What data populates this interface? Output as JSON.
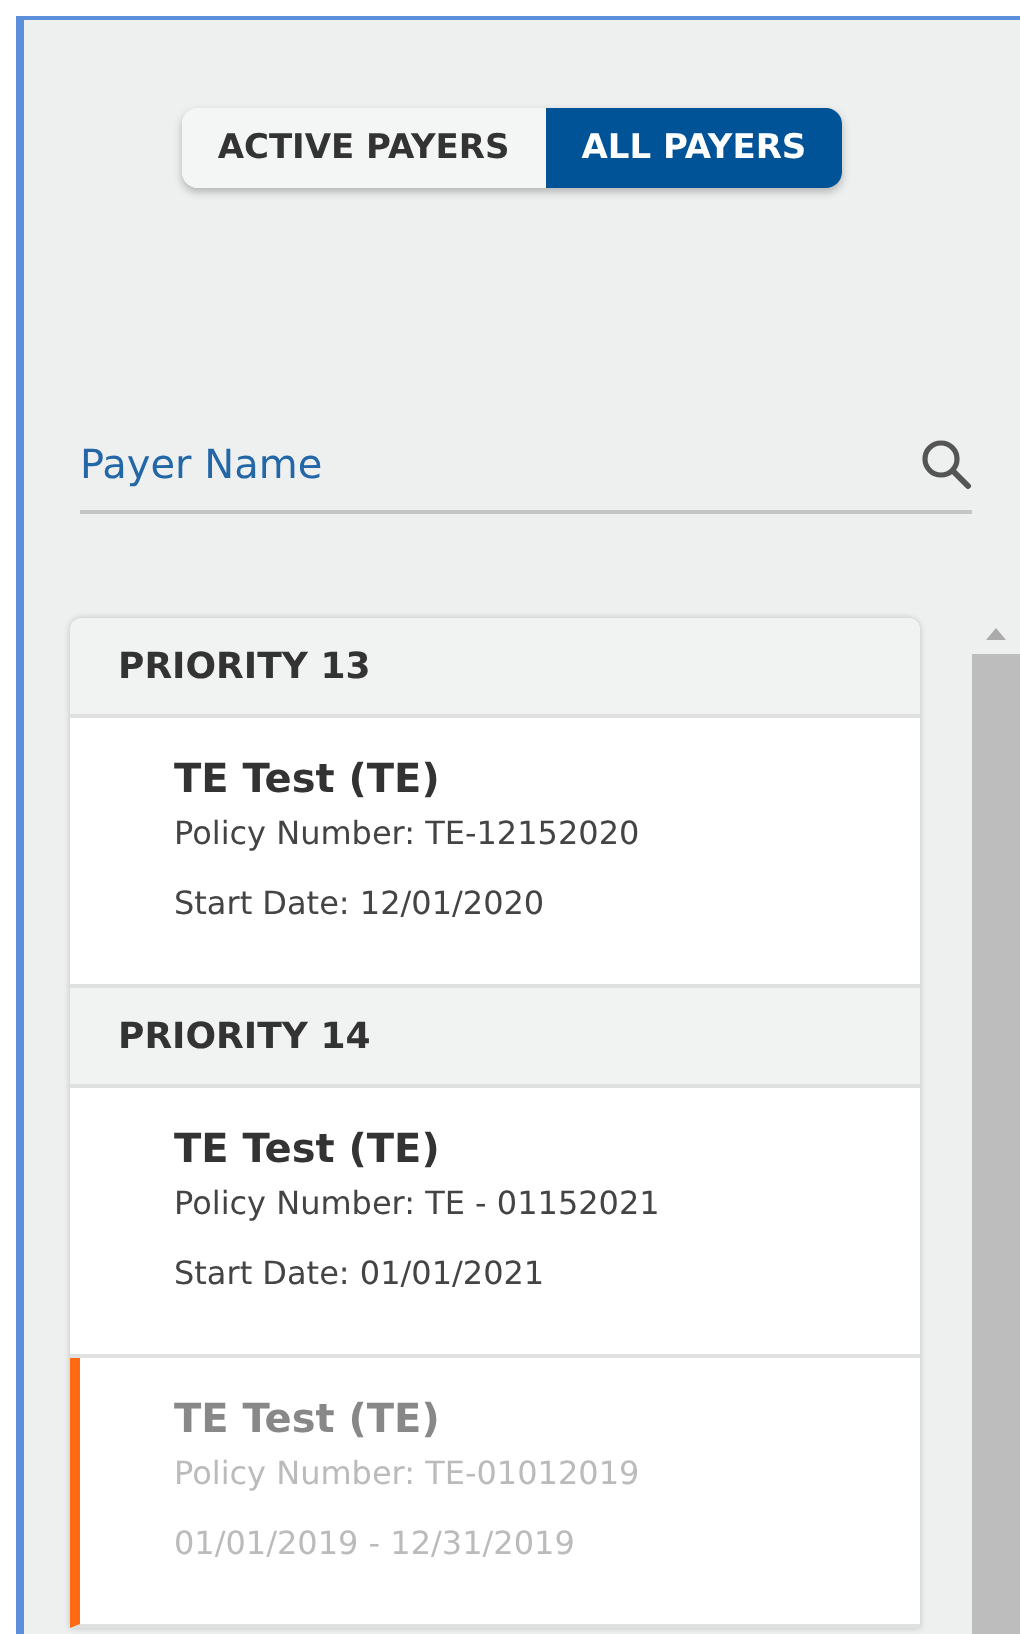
{
  "toggle": [
    {
      "label": "ACTIVE PAYERS",
      "selected": false
    },
    {
      "label": "ALL PAYERS",
      "selected": true
    }
  ],
  "search": {
    "placeholder": "Payer Name"
  },
  "groups": [
    {
      "title": "PRIORITY 13",
      "payers": [
        {
          "name": "TE Test (TE)",
          "policy": "Policy Number: TE-12152020",
          "date": "Start Date: 12/01/2020",
          "expired": false
        }
      ]
    },
    {
      "title": "PRIORITY 14",
      "payers": [
        {
          "name": "TE Test (TE)",
          "policy": "Policy Number: TE - 01152021",
          "date": "Start Date: 01/01/2021",
          "expired": false
        },
        {
          "name": "TE Test (TE)",
          "policy": "Policy Number: TE-01012019",
          "date": "01/01/2019 - 12/31/2019",
          "expired": true
        }
      ]
    }
  ]
}
